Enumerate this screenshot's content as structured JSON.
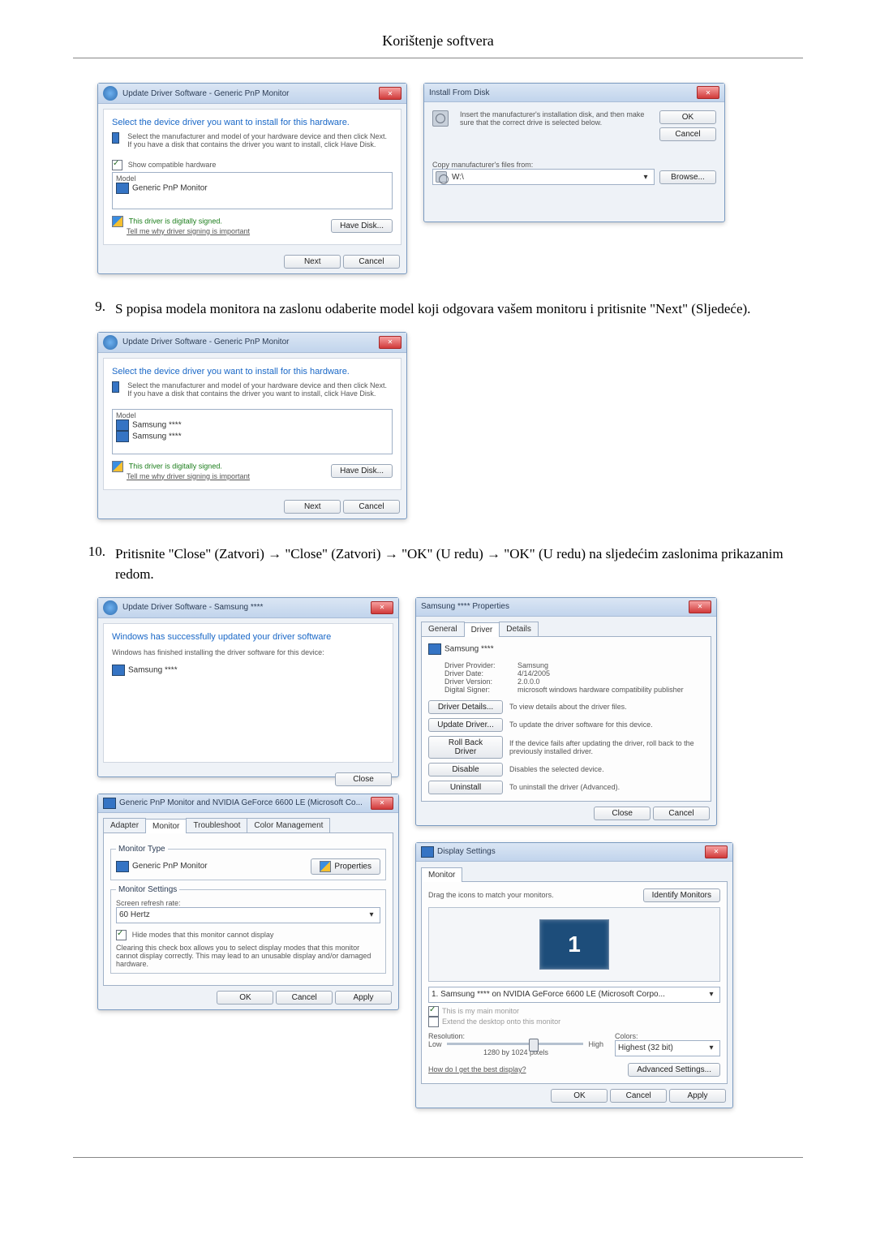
{
  "page_title": "Korištenje softvera",
  "steps": [
    {
      "num": "9.",
      "text": "S popisa modela monitora na zaslonu odaberite model koji odgovara vašem monitoru i pritisnite \"Next\" (Sljedeće)."
    },
    {
      "num": "10.",
      "text": "Pritisnite \"Close\" (Zatvori) → \"Close\" (Zatvori) → \"OK\" (U redu) → \"OK\" (U redu) na sljedećim zaslonima prikazanim redom."
    }
  ],
  "dlg_update1": {
    "title": "Update Driver Software - Generic PnP Monitor",
    "heading": "Select the device driver you want to install for this hardware.",
    "hint": "Select the manufacturer and model of your hardware device and then click Next. If you have a disk that contains the driver you want to install, click Have Disk.",
    "compat_label": "Show compatible hardware",
    "model_label": "Model",
    "model_item": "Generic PnP Monitor",
    "signed": "This driver is digitally signed.",
    "signed_link": "Tell me why driver signing is important",
    "have_disk": "Have Disk...",
    "next": "Next",
    "cancel": "Cancel"
  },
  "dlg_install": {
    "title": "Install From Disk",
    "hint": "Insert the manufacturer's installation disk, and then make sure that the correct drive is selected below.",
    "ok": "OK",
    "cancel": "Cancel",
    "copy_label": "Copy manufacturer's files from:",
    "path": "W:\\",
    "browse": "Browse..."
  },
  "dlg_update2": {
    "title": "Update Driver Software - Generic PnP Monitor",
    "heading": "Select the device driver you want to install for this hardware.",
    "hint": "Select the manufacturer and model of your hardware device and then click Next. If you have a disk that contains the driver you want to install, click Have Disk.",
    "model_label": "Model",
    "item1": "Samsung ****",
    "item2": "Samsung ****",
    "signed": "This driver is digitally signed.",
    "signed_link": "Tell me why driver signing is important",
    "have_disk": "Have Disk...",
    "next": "Next",
    "cancel": "Cancel"
  },
  "dlg_close": {
    "title": "Update Driver Software - Samsung ****",
    "heading": "Windows has successfully updated your driver software",
    "subtext": "Windows has finished installing the driver software for this device:",
    "device": "Samsung ****",
    "close": "Close"
  },
  "dlg_props": {
    "title": "Samsung **** Properties",
    "tabs": [
      "General",
      "Driver",
      "Details"
    ],
    "active_tab": 1,
    "device": "Samsung ****",
    "rows": {
      "provider_l": "Driver Provider:",
      "provider_v": "Samsung",
      "date_l": "Driver Date:",
      "date_v": "4/14/2005",
      "ver_l": "Driver Version:",
      "ver_v": "2.0.0.0",
      "signer_l": "Digital Signer:",
      "signer_v": "microsoft windows hardware compatibility publisher"
    },
    "b_details": "Driver Details...",
    "b_details_t": "To view details about the driver files.",
    "b_update": "Update Driver...",
    "b_update_t": "To update the driver software for this device.",
    "b_roll": "Roll Back Driver",
    "b_roll_t": "If the device fails after updating the driver, roll back to the previously installed driver.",
    "b_disable": "Disable",
    "b_disable_t": "Disables the selected device.",
    "b_uninst": "Uninstall",
    "b_uninst_t": "To uninstall the driver (Advanced).",
    "close": "Close",
    "cancel": "Cancel"
  },
  "dlg_adapter": {
    "title": "Generic PnP Monitor and NVIDIA GeForce 6600 LE (Microsoft Co...",
    "tabs": [
      "Adapter",
      "Monitor",
      "Troubleshoot",
      "Color Management"
    ],
    "active_tab": 1,
    "mtype_l": "Monitor Type",
    "mtype_v": "Generic PnP Monitor",
    "props_btn": "Properties",
    "msettings_l": "Monitor Settings",
    "refresh_l": "Screen refresh rate:",
    "refresh_v": "60 Hertz",
    "hide_l": "Hide modes that this monitor cannot display",
    "hide_note": "Clearing this check box allows you to select display modes that this monitor cannot display correctly. This may lead to an unusable display and/or damaged hardware.",
    "ok": "OK",
    "cancel": "Cancel",
    "apply": "Apply"
  },
  "dlg_disp": {
    "title": "Display Settings",
    "tab": "Monitor",
    "drag": "Drag the icons to match your monitors.",
    "identify": "Identify Monitors",
    "mon_num": "1",
    "sel_label": "1. Samsung **** on NVIDIA GeForce 6600 LE (Microsoft Corpo...",
    "main_chk": "This is my main monitor",
    "extend_chk": "Extend the desktop onto this monitor",
    "res_l": "Resolution:",
    "low": "Low",
    "high": "High",
    "res_v": "1280 by 1024 pixels",
    "col_l": "Colors:",
    "col_v": "Highest (32 bit)",
    "best_link": "How do I get the best display?",
    "adv": "Advanced Settings...",
    "ok": "OK",
    "cancel": "Cancel",
    "apply": "Apply"
  }
}
